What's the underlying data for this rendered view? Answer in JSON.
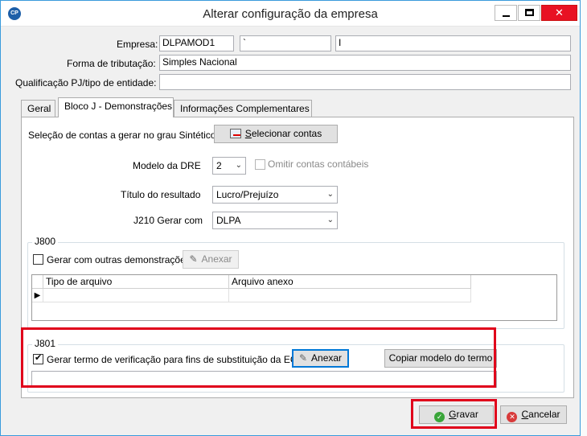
{
  "window": {
    "title": "Alterar configuração da empresa",
    "logo_text": "CP",
    "minimize": "—",
    "maximize": "",
    "close": "✕"
  },
  "form": {
    "empresa_label": "Empresa:",
    "empresa_code": "DLPAMOD1",
    "empresa_field2": "`",
    "empresa_field3": "I",
    "tributacao_label": "Forma de tributação:",
    "tributacao_value": "Simples Nacional",
    "qualificacao_label": "Qualificação PJ/tipo de entidade:",
    "qualificacao_value": ""
  },
  "tabs": [
    {
      "label": "Geral"
    },
    {
      "label": "Bloco J - Demonstrações"
    },
    {
      "label": "Informações Complementares"
    }
  ],
  "bloco_j": {
    "selecao_label": "Seleção de contas a gerar no grau Sintético",
    "selecionar_button": "Selecionar contas",
    "selecionar_underline": "S",
    "selecionar_rest": "elecionar contas",
    "modelo_dre_label": "Modelo da DRE",
    "modelo_dre_value": "2",
    "omitir_label": "Omitir contas contábeis",
    "titulo_resultado_label": "Título do resultado",
    "titulo_resultado_value": "Lucro/Prejuízo",
    "j210_label": "J210 Gerar com",
    "j210_value": "DLPA"
  },
  "j800": {
    "title": "J800",
    "gerar_label": "Gerar com outras demonstrações",
    "anexar_button": "Anexar",
    "columns": [
      "Tipo de arquivo",
      "Arquivo anexo"
    ],
    "row_marker": "▶"
  },
  "j801": {
    "title": "J801",
    "gerar_termo_label": "Gerar termo de verificação para fins de substituição da ECD",
    "gerar_termo_checked": true,
    "anexar_button": "Anexar",
    "copiar_button": "Copiar modelo do termo",
    "file_value": ""
  },
  "footer": {
    "gravar_u": "G",
    "gravar_rest": "ravar",
    "cancelar_u": "C",
    "cancelar_rest": "ancelar"
  },
  "icons": {
    "combo_arrow": "⌄",
    "check_green": "✓",
    "cancel_red": "✕",
    "clip": "✎"
  },
  "colors": {
    "highlight": "#e0001b",
    "title_close": "#e81123"
  }
}
